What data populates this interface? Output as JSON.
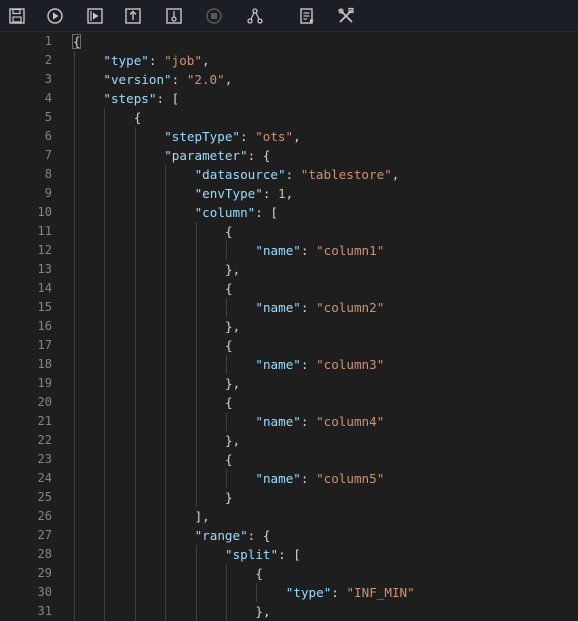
{
  "toolbar": {
    "buttons": [
      {
        "name": "save-icon"
      },
      {
        "name": "run-icon"
      },
      {
        "name": "run-selection-icon"
      },
      {
        "name": "upload-icon"
      },
      {
        "name": "parameters-icon"
      },
      {
        "name": "stop-icon"
      },
      {
        "name": "schedule-icon"
      },
      {
        "name": "format-icon"
      },
      {
        "name": "tools-icon"
      }
    ]
  },
  "editor": {
    "line_numbers": [
      "1",
      "2",
      "3",
      "4",
      "5",
      "6",
      "7",
      "8",
      "9",
      "10",
      "11",
      "12",
      "13",
      "14",
      "15",
      "16",
      "17",
      "18",
      "19",
      "20",
      "21",
      "22",
      "23",
      "24",
      "25",
      "26",
      "27",
      "28",
      "29",
      "30",
      "31"
    ],
    "lines": [
      {
        "indent": 0,
        "tokens": [
          {
            "t": "{",
            "c": "p"
          }
        ]
      },
      {
        "indent": 1,
        "tokens": [
          {
            "t": "\"type\"",
            "c": "k"
          },
          {
            "t": ": ",
            "c": "p"
          },
          {
            "t": "\"job\"",
            "c": "s"
          },
          {
            "t": ",",
            "c": "p"
          }
        ]
      },
      {
        "indent": 1,
        "tokens": [
          {
            "t": "\"version\"",
            "c": "k"
          },
          {
            "t": ": ",
            "c": "p"
          },
          {
            "t": "\"2.0\"",
            "c": "s"
          },
          {
            "t": ",",
            "c": "p"
          }
        ]
      },
      {
        "indent": 1,
        "tokens": [
          {
            "t": "\"steps\"",
            "c": "k"
          },
          {
            "t": ": [",
            "c": "p"
          }
        ]
      },
      {
        "indent": 2,
        "tokens": [
          {
            "t": "{",
            "c": "p"
          }
        ]
      },
      {
        "indent": 3,
        "tokens": [
          {
            "t": "\"stepType\"",
            "c": "k"
          },
          {
            "t": ": ",
            "c": "p"
          },
          {
            "t": "\"ots\"",
            "c": "s"
          },
          {
            "t": ",",
            "c": "p"
          }
        ]
      },
      {
        "indent": 3,
        "tokens": [
          {
            "t": "\"parameter\"",
            "c": "k"
          },
          {
            "t": ": {",
            "c": "p"
          }
        ]
      },
      {
        "indent": 4,
        "tokens": [
          {
            "t": "\"datasource\"",
            "c": "k"
          },
          {
            "t": ": ",
            "c": "p"
          },
          {
            "t": "\"tablestore\"",
            "c": "s"
          },
          {
            "t": ",",
            "c": "p"
          }
        ]
      },
      {
        "indent": 4,
        "tokens": [
          {
            "t": "\"envType\"",
            "c": "k"
          },
          {
            "t": ": ",
            "c": "p"
          },
          {
            "t": "1",
            "c": "n"
          },
          {
            "t": ",",
            "c": "p"
          }
        ]
      },
      {
        "indent": 4,
        "tokens": [
          {
            "t": "\"column\"",
            "c": "k"
          },
          {
            "t": ": [",
            "c": "p"
          }
        ]
      },
      {
        "indent": 5,
        "tokens": [
          {
            "t": "{",
            "c": "p"
          }
        ]
      },
      {
        "indent": 6,
        "tokens": [
          {
            "t": "\"name\"",
            "c": "k"
          },
          {
            "t": ": ",
            "c": "p"
          },
          {
            "t": "\"column1\"",
            "c": "s"
          }
        ]
      },
      {
        "indent": 5,
        "tokens": [
          {
            "t": "},",
            "c": "p"
          }
        ]
      },
      {
        "indent": 5,
        "tokens": [
          {
            "t": "{",
            "c": "p"
          }
        ]
      },
      {
        "indent": 6,
        "tokens": [
          {
            "t": "\"name\"",
            "c": "k"
          },
          {
            "t": ": ",
            "c": "p"
          },
          {
            "t": "\"column2\"",
            "c": "s"
          }
        ]
      },
      {
        "indent": 5,
        "tokens": [
          {
            "t": "},",
            "c": "p"
          }
        ]
      },
      {
        "indent": 5,
        "tokens": [
          {
            "t": "{",
            "c": "p"
          }
        ]
      },
      {
        "indent": 6,
        "tokens": [
          {
            "t": "\"name\"",
            "c": "k"
          },
          {
            "t": ": ",
            "c": "p"
          },
          {
            "t": "\"column3\"",
            "c": "s"
          }
        ]
      },
      {
        "indent": 5,
        "tokens": [
          {
            "t": "},",
            "c": "p"
          }
        ]
      },
      {
        "indent": 5,
        "tokens": [
          {
            "t": "{",
            "c": "p"
          }
        ]
      },
      {
        "indent": 6,
        "tokens": [
          {
            "t": "\"name\"",
            "c": "k"
          },
          {
            "t": ": ",
            "c": "p"
          },
          {
            "t": "\"column4\"",
            "c": "s"
          }
        ]
      },
      {
        "indent": 5,
        "tokens": [
          {
            "t": "},",
            "c": "p"
          }
        ]
      },
      {
        "indent": 5,
        "tokens": [
          {
            "t": "{",
            "c": "p"
          }
        ]
      },
      {
        "indent": 6,
        "tokens": [
          {
            "t": "\"name\"",
            "c": "k"
          },
          {
            "t": ": ",
            "c": "p"
          },
          {
            "t": "\"column5\"",
            "c": "s"
          }
        ]
      },
      {
        "indent": 5,
        "tokens": [
          {
            "t": "}",
            "c": "p"
          }
        ]
      },
      {
        "indent": 4,
        "tokens": [
          {
            "t": "],",
            "c": "p"
          }
        ]
      },
      {
        "indent": 4,
        "tokens": [
          {
            "t": "\"range\"",
            "c": "k"
          },
          {
            "t": ": {",
            "c": "p"
          }
        ]
      },
      {
        "indent": 5,
        "tokens": [
          {
            "t": "\"split\"",
            "c": "k"
          },
          {
            "t": ": [",
            "c": "p"
          }
        ]
      },
      {
        "indent": 6,
        "tokens": [
          {
            "t": "{",
            "c": "p"
          }
        ]
      },
      {
        "indent": 7,
        "tokens": [
          {
            "t": "\"type\"",
            "c": "k"
          },
          {
            "t": ": ",
            "c": "p"
          },
          {
            "t": "\"INF_MIN\"",
            "c": "s"
          }
        ]
      },
      {
        "indent": 6,
        "tokens": [
          {
            "t": "},",
            "c": "p"
          }
        ]
      }
    ]
  },
  "colors": {
    "key": "#9cdcfe",
    "string": "#ce9178",
    "number": "#b5cea8",
    "punctuation": "#d4d4d4",
    "background": "#1e1e1e",
    "line_number": "#858585"
  }
}
